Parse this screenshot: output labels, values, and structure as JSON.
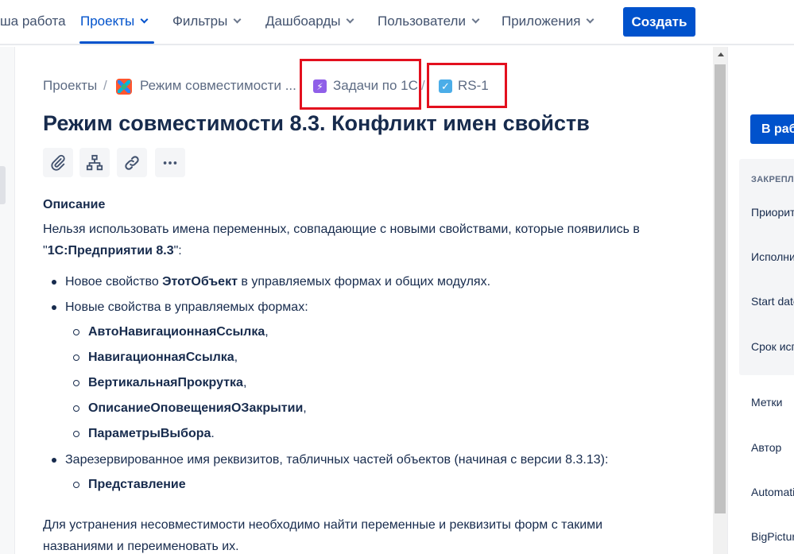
{
  "nav": {
    "your_work": "ша работа",
    "projects": "Проекты",
    "filters": "Фильтры",
    "dashboards": "Дашбоарды",
    "users": "Пользователи",
    "apps": "Приложения",
    "create": "Создать"
  },
  "breadcrumb": {
    "projects": "Проекты",
    "project": "Режим совместимости ...",
    "parent": "Задачи по 1С",
    "issue_key": "RS-1",
    "separator": "/"
  },
  "issue": {
    "title": "Режим совместимости 8.3. Конфликт имен свойств"
  },
  "toolbar": {
    "icons": [
      "paperclip-icon",
      "child-issues-icon",
      "link-icon",
      "more-icon"
    ]
  },
  "description": {
    "heading": "Описание",
    "intro_line1": "Нельзя использовать имена переменных, совпадающие с новыми свойствами, которые появились в",
    "intro_quote_open": "\"",
    "intro_bold": "1С:Предприятии 8.3",
    "intro_quote_close": "\":",
    "b1_pre": "Новое свойство ",
    "b1_bold": "ЭтотОбъект",
    "b1_post": " в управляемых формах и общих модулях.",
    "b2": "Новые свойства в управляемых формах:",
    "sub": [
      {
        "bold": "АвтоНавигационнаяСсылка",
        "tail": ","
      },
      {
        "bold": "НавигационнаяСсылка",
        "tail": ","
      },
      {
        "bold": "ВертикальнаяПрокрутка",
        "tail": ","
      },
      {
        "bold": "ОписаниеОповещенияОЗакрытии",
        "tail": ","
      },
      {
        "bold": "ПараметрыВыбора",
        "tail": "."
      }
    ],
    "b3": "Зарезервированное имя реквизитов, табличных частей объектов (начиная с версии 8.3.13):",
    "b3_sub": "Представление",
    "outro_line1": "Для устранения несовместимости необходимо найти переменные и реквизиты форм с такими",
    "outro_line2": "названиями и переименовать их."
  },
  "side": {
    "in_work": "В работе",
    "pinned": "ЗАКРЕПЛЁННЫЕ",
    "priority": "Приоритет",
    "assignee": "Исполнитель",
    "start_date": "Start date",
    "due": "Срок исполнения",
    "labels": "Метки",
    "author": "Автор",
    "automation": "Automation",
    "bigpicture": "BigPicture"
  },
  "colors": {
    "accent": "#0052cc",
    "highlight": "#e3101e",
    "text": "#172b4d"
  }
}
